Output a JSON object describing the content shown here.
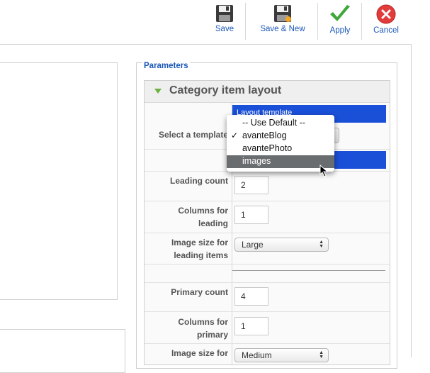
{
  "toolbar": {
    "buttons": [
      {
        "label": "Save",
        "icon": "floppy-disk-icon"
      },
      {
        "label": "Save & New",
        "icon": "floppy-disk-icon"
      },
      {
        "label": "Apply",
        "icon": "green-checkmark-icon"
      },
      {
        "label": "Cancel",
        "icon": "red-x-circle-icon"
      }
    ]
  },
  "parameters": {
    "legend": "Parameters",
    "section_title": "Category item layout",
    "layout_template_label": "Layout template",
    "select_template_label": "Select a template",
    "dropdown": {
      "options": [
        "-- Use Default --",
        "avanteBlog",
        "avantePhoto",
        "images"
      ],
      "checked": "avanteBlog",
      "highlighted": "images"
    },
    "leading_count": {
      "label": "Leading count",
      "value": "2"
    },
    "columns_leading": {
      "label_1": "Columns for",
      "label_2": "leading",
      "value": "1"
    },
    "image_size_leading": {
      "label_1": "Image size for",
      "label_2": "leading items",
      "value": "Large"
    },
    "primary_count": {
      "label": "Primary count",
      "value": "4"
    },
    "columns_primary": {
      "label_1": "Columns for",
      "label_2": "primary",
      "value": "1"
    },
    "image_size_primary": {
      "label_1": "Image size for",
      "value": "Medium"
    }
  },
  "colors": {
    "link_blue": "#1a57b8",
    "highlight_blue": "#1a4fd8",
    "accent_green": "#6cb33f",
    "cancel_red": "#e23b3b"
  }
}
